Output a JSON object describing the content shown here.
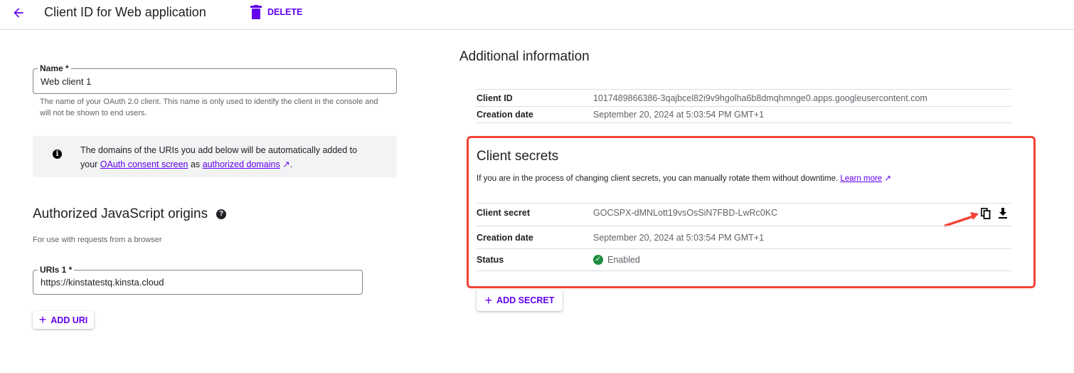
{
  "header": {
    "title": "Client ID for Web application",
    "delete_label": "DELETE"
  },
  "name_field": {
    "label": "Name *",
    "value": "Web client 1",
    "hint": "The name of your OAuth 2.0 client. This name is only used to identify the client in the console and will not be shown to end users."
  },
  "info_banner": {
    "text1": "The domains of the URIs you add below will be automatically added to",
    "text2_prefix": "your ",
    "link1": "OAuth consent screen",
    "text2_mid": " as ",
    "link2": "authorized domains",
    "text2_suffix": "."
  },
  "origins": {
    "title": "Authorized JavaScript origins",
    "subtitle": "For use with requests from a browser",
    "uri_label": "URIs 1 *",
    "uri_value": "https://kinstatestq.kinsta.cloud",
    "add_uri": "ADD URI"
  },
  "additional": {
    "title": "Additional information",
    "rows": [
      {
        "key": "Client ID",
        "value": "1017489866386-3qajbcel82i9v9hgolha6b8dmqhmnge0.apps.googleusercontent.com"
      },
      {
        "key": "Creation date",
        "value": "September 20, 2024 at 5:03:54 PM GMT+1"
      }
    ]
  },
  "secrets": {
    "title": "Client secrets",
    "desc": "If you are in the process of changing client secrets, you can manually rotate them without downtime. ",
    "learn_more": "Learn more",
    "rows": [
      {
        "key": "Client secret",
        "value": "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"
      },
      {
        "key": "Creation date",
        "value": "September 20, 2024 at 5:03:54 PM GMT+1"
      },
      {
        "key": "Status",
        "value": "Enabled"
      }
    ],
    "add_secret": "ADD SECRET"
  },
  "colors": {
    "accent": "#6200ee",
    "highlight": "#f44336",
    "success": "#1e8e3e"
  }
}
